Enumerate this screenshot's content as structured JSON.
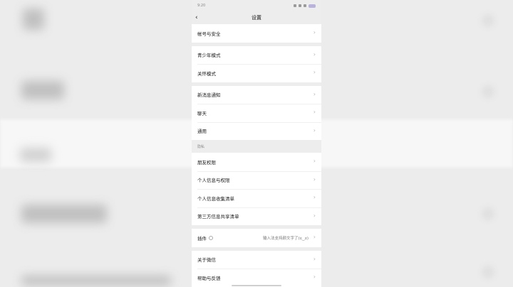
{
  "status": {
    "time": "9:20",
    "battery_color": "#b8b2dc"
  },
  "nav": {
    "title": "设置",
    "back_icon": "chevron-left-icon"
  },
  "groups": [
    {
      "rows": [
        "帐号与安全"
      ]
    },
    {
      "rows": [
        "青少年模式",
        "关怀模式"
      ]
    },
    {
      "rows": [
        "新消息通知",
        "聊天",
        "通用"
      ]
    }
  ],
  "privacy": {
    "label": "隐私",
    "rows": [
      "朋友权限",
      "个人信息与权限",
      "个人信息收集清单",
      "第三方信息共享清单"
    ]
  },
  "plugin": {
    "label": "插件",
    "value": "输入法支持颜文字了(ಠ‿ಠ)"
  },
  "bottom": {
    "rows": [
      "关于微信",
      "帮助与反馈"
    ]
  },
  "colors": {
    "background": "#ededed",
    "card": "#ffffff",
    "chevron": "#b5b5b5"
  }
}
